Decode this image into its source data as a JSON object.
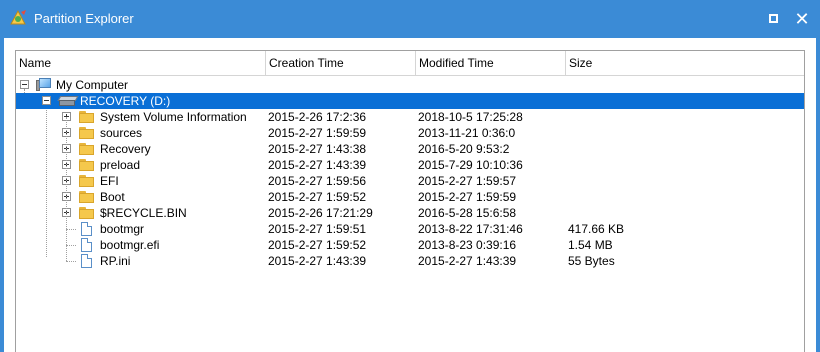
{
  "window": {
    "title": "Partition Explorer"
  },
  "columns": {
    "name": "Name",
    "creation": "Creation Time",
    "modified": "Modified Time",
    "size": "Size"
  },
  "tree": {
    "root": "My Computer",
    "drive": "RECOVERY (D:)",
    "items": [
      {
        "name": "System Volume Information",
        "creation": "2015-2-26 17:2:36",
        "modified": "2018-10-5 17:25:28",
        "size": "",
        "type": "folder"
      },
      {
        "name": "sources",
        "creation": "2015-2-27 1:59:59",
        "modified": "2013-11-21 0:36:0",
        "size": "",
        "type": "folder"
      },
      {
        "name": "Recovery",
        "creation": "2015-2-27 1:43:38",
        "modified": "2016-5-20 9:53:2",
        "size": "",
        "type": "folder"
      },
      {
        "name": "preload",
        "creation": "2015-2-27 1:43:39",
        "modified": "2015-7-29 10:10:36",
        "size": "",
        "type": "folder"
      },
      {
        "name": "EFI",
        "creation": "2015-2-27 1:59:56",
        "modified": "2015-2-27 1:59:57",
        "size": "",
        "type": "folder"
      },
      {
        "name": "Boot",
        "creation": "2015-2-27 1:59:52",
        "modified": "2015-2-27 1:59:59",
        "size": "",
        "type": "folder"
      },
      {
        "name": "$RECYCLE.BIN",
        "creation": "2015-2-26 17:21:29",
        "modified": "2016-5-28 15:6:58",
        "size": "",
        "type": "folder"
      },
      {
        "name": "bootmgr",
        "creation": "2015-2-27 1:59:51",
        "modified": "2013-8-22 17:31:46",
        "size": "417.66 KB",
        "type": "file"
      },
      {
        "name": "bootmgr.efi",
        "creation": "2015-2-27 1:59:52",
        "modified": "2013-8-23 0:39:16",
        "size": "1.54 MB",
        "type": "file"
      },
      {
        "name": "RP.ini",
        "creation": "2015-2-27 1:43:39",
        "modified": "2015-2-27 1:43:39",
        "size": "55 Bytes",
        "type": "file"
      }
    ]
  },
  "icons": {
    "app": "partition-explorer-icon",
    "maximize": "maximize-icon",
    "close": "close-icon",
    "computer": "computer-icon",
    "drive": "drive-icon",
    "folder": "folder-icon",
    "file": "file-icon"
  },
  "colors": {
    "titlebar": "#3b8bd6",
    "selection": "#0a6fd6",
    "folder": "#f5c84c"
  }
}
